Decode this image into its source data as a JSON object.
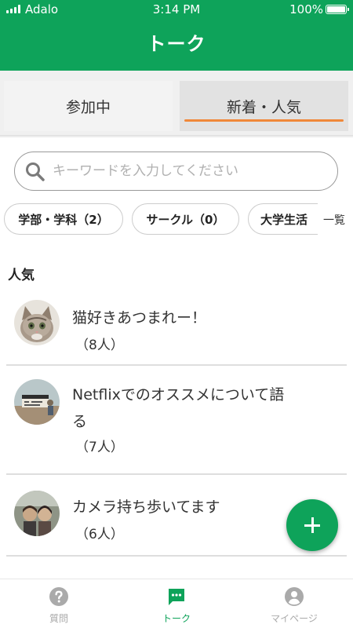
{
  "status_bar": {
    "carrier": "Adalo",
    "time": "3:14 PM",
    "battery": "100%"
  },
  "header": {
    "title": "トーク"
  },
  "tabs": [
    {
      "label": "参加中",
      "selected": false
    },
    {
      "label": "新着・人気",
      "selected": true
    }
  ],
  "search": {
    "placeholder": "キーワードを入力してください",
    "value": ""
  },
  "chips": [
    {
      "label": "学部・学科（2）"
    },
    {
      "label": "サークル（0）"
    },
    {
      "label": "大学生活"
    }
  ],
  "see_all_label": "一覧",
  "section": {
    "title": "人気"
  },
  "rooms": [
    {
      "name": "猫好きあつまれー！",
      "count": "（8人）"
    },
    {
      "name": "Netflixでのオススメについて語る",
      "count": "（7人）"
    },
    {
      "name": "カメラ持ち歩いてます",
      "count": "（6人）"
    }
  ],
  "bottom_nav": [
    {
      "label": "質問",
      "icon": "question-circle-icon",
      "active": false
    },
    {
      "label": "トーク",
      "icon": "chat-bubble-icon",
      "active": true
    },
    {
      "label": "マイページ",
      "icon": "account-circle-icon",
      "active": false
    }
  ],
  "colors": {
    "brand_green": "#0ea35a",
    "tab_indicator": "#f0883a",
    "inactive_nav": "#aaaaaa"
  }
}
